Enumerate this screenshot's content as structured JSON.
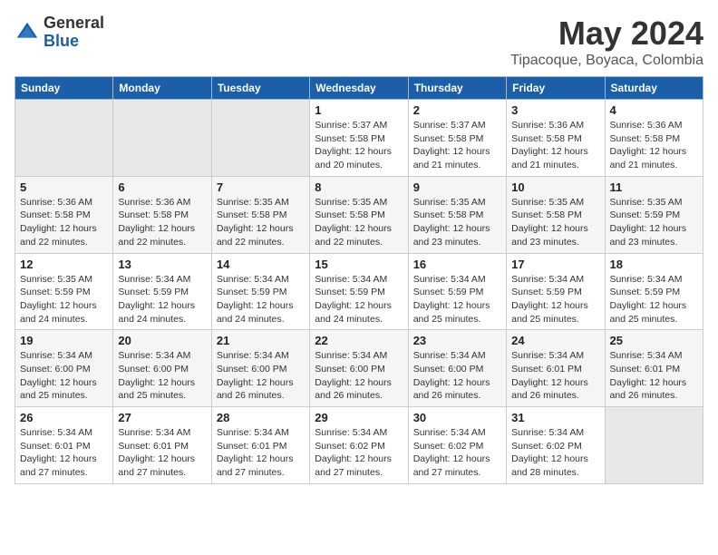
{
  "logo": {
    "general": "General",
    "blue": "Blue"
  },
  "title": {
    "month": "May 2024",
    "location": "Tipacoque, Boyaca, Colombia"
  },
  "weekdays": [
    "Sunday",
    "Monday",
    "Tuesday",
    "Wednesday",
    "Thursday",
    "Friday",
    "Saturday"
  ],
  "weeks": [
    [
      {
        "day": "",
        "info": ""
      },
      {
        "day": "",
        "info": ""
      },
      {
        "day": "",
        "info": ""
      },
      {
        "day": "1",
        "info": "Sunrise: 5:37 AM\nSunset: 5:58 PM\nDaylight: 12 hours\nand 20 minutes."
      },
      {
        "day": "2",
        "info": "Sunrise: 5:37 AM\nSunset: 5:58 PM\nDaylight: 12 hours\nand 21 minutes."
      },
      {
        "day": "3",
        "info": "Sunrise: 5:36 AM\nSunset: 5:58 PM\nDaylight: 12 hours\nand 21 minutes."
      },
      {
        "day": "4",
        "info": "Sunrise: 5:36 AM\nSunset: 5:58 PM\nDaylight: 12 hours\nand 21 minutes."
      }
    ],
    [
      {
        "day": "5",
        "info": "Sunrise: 5:36 AM\nSunset: 5:58 PM\nDaylight: 12 hours\nand 22 minutes."
      },
      {
        "day": "6",
        "info": "Sunrise: 5:36 AM\nSunset: 5:58 PM\nDaylight: 12 hours\nand 22 minutes."
      },
      {
        "day": "7",
        "info": "Sunrise: 5:35 AM\nSunset: 5:58 PM\nDaylight: 12 hours\nand 22 minutes."
      },
      {
        "day": "8",
        "info": "Sunrise: 5:35 AM\nSunset: 5:58 PM\nDaylight: 12 hours\nand 22 minutes."
      },
      {
        "day": "9",
        "info": "Sunrise: 5:35 AM\nSunset: 5:58 PM\nDaylight: 12 hours\nand 23 minutes."
      },
      {
        "day": "10",
        "info": "Sunrise: 5:35 AM\nSunset: 5:58 PM\nDaylight: 12 hours\nand 23 minutes."
      },
      {
        "day": "11",
        "info": "Sunrise: 5:35 AM\nSunset: 5:59 PM\nDaylight: 12 hours\nand 23 minutes."
      }
    ],
    [
      {
        "day": "12",
        "info": "Sunrise: 5:35 AM\nSunset: 5:59 PM\nDaylight: 12 hours\nand 24 minutes."
      },
      {
        "day": "13",
        "info": "Sunrise: 5:34 AM\nSunset: 5:59 PM\nDaylight: 12 hours\nand 24 minutes."
      },
      {
        "day": "14",
        "info": "Sunrise: 5:34 AM\nSunset: 5:59 PM\nDaylight: 12 hours\nand 24 minutes."
      },
      {
        "day": "15",
        "info": "Sunrise: 5:34 AM\nSunset: 5:59 PM\nDaylight: 12 hours\nand 24 minutes."
      },
      {
        "day": "16",
        "info": "Sunrise: 5:34 AM\nSunset: 5:59 PM\nDaylight: 12 hours\nand 25 minutes."
      },
      {
        "day": "17",
        "info": "Sunrise: 5:34 AM\nSunset: 5:59 PM\nDaylight: 12 hours\nand 25 minutes."
      },
      {
        "day": "18",
        "info": "Sunrise: 5:34 AM\nSunset: 5:59 PM\nDaylight: 12 hours\nand 25 minutes."
      }
    ],
    [
      {
        "day": "19",
        "info": "Sunrise: 5:34 AM\nSunset: 6:00 PM\nDaylight: 12 hours\nand 25 minutes."
      },
      {
        "day": "20",
        "info": "Sunrise: 5:34 AM\nSunset: 6:00 PM\nDaylight: 12 hours\nand 25 minutes."
      },
      {
        "day": "21",
        "info": "Sunrise: 5:34 AM\nSunset: 6:00 PM\nDaylight: 12 hours\nand 26 minutes."
      },
      {
        "day": "22",
        "info": "Sunrise: 5:34 AM\nSunset: 6:00 PM\nDaylight: 12 hours\nand 26 minutes."
      },
      {
        "day": "23",
        "info": "Sunrise: 5:34 AM\nSunset: 6:00 PM\nDaylight: 12 hours\nand 26 minutes."
      },
      {
        "day": "24",
        "info": "Sunrise: 5:34 AM\nSunset: 6:01 PM\nDaylight: 12 hours\nand 26 minutes."
      },
      {
        "day": "25",
        "info": "Sunrise: 5:34 AM\nSunset: 6:01 PM\nDaylight: 12 hours\nand 26 minutes."
      }
    ],
    [
      {
        "day": "26",
        "info": "Sunrise: 5:34 AM\nSunset: 6:01 PM\nDaylight: 12 hours\nand 27 minutes."
      },
      {
        "day": "27",
        "info": "Sunrise: 5:34 AM\nSunset: 6:01 PM\nDaylight: 12 hours\nand 27 minutes."
      },
      {
        "day": "28",
        "info": "Sunrise: 5:34 AM\nSunset: 6:01 PM\nDaylight: 12 hours\nand 27 minutes."
      },
      {
        "day": "29",
        "info": "Sunrise: 5:34 AM\nSunset: 6:02 PM\nDaylight: 12 hours\nand 27 minutes."
      },
      {
        "day": "30",
        "info": "Sunrise: 5:34 AM\nSunset: 6:02 PM\nDaylight: 12 hours\nand 27 minutes."
      },
      {
        "day": "31",
        "info": "Sunrise: 5:34 AM\nSunset: 6:02 PM\nDaylight: 12 hours\nand 28 minutes."
      },
      {
        "day": "",
        "info": ""
      }
    ]
  ]
}
